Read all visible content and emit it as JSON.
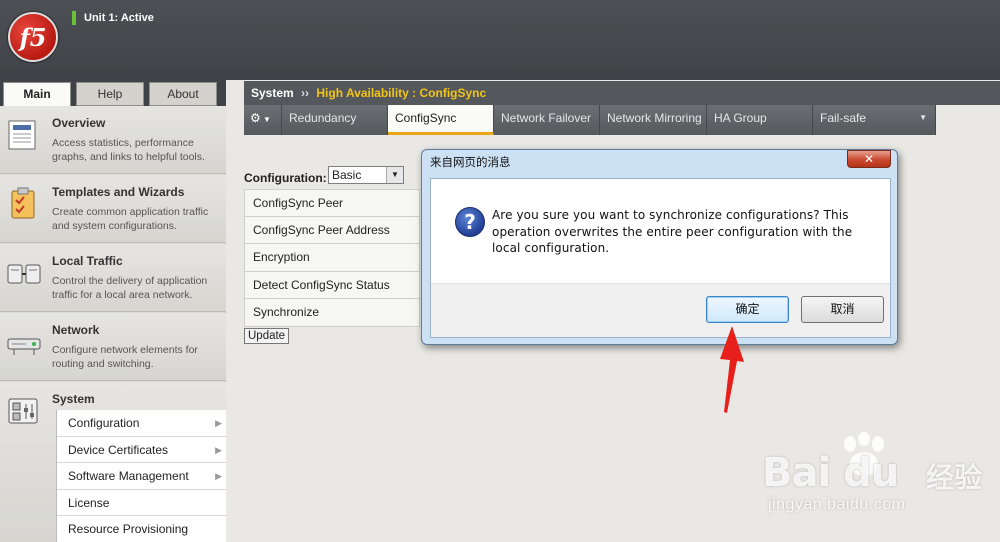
{
  "header": {
    "logo_text": "f5",
    "unit_status": "Unit 1: Active"
  },
  "sidebar": {
    "tabs": [
      {
        "label": "Main",
        "active": true
      },
      {
        "label": "Help",
        "active": false
      },
      {
        "label": "About",
        "active": false
      }
    ],
    "sections": [
      {
        "title": "Overview",
        "description": "Access statistics, performance graphs, and links to helpful tools.",
        "icon": "overview-icon"
      },
      {
        "title": "Templates and Wizards",
        "description": "Create common application traffic and system configurations.",
        "icon": "wizard-icon"
      },
      {
        "title": "Local Traffic",
        "description": "Control the delivery of application traffic for a local area network.",
        "icon": "local-traffic-icon"
      },
      {
        "title": "Network",
        "description": "Configure network elements for routing and switching.",
        "icon": "network-icon"
      },
      {
        "title": "System",
        "description": "",
        "icon": "system-icon"
      }
    ],
    "system_menu": [
      {
        "label": "Configuration",
        "has_submenu": true
      },
      {
        "label": "Device Certificates",
        "has_submenu": true
      },
      {
        "label": "Software Management",
        "has_submenu": true
      },
      {
        "label": "License",
        "has_submenu": false
      },
      {
        "label": "Resource Provisioning",
        "has_submenu": false
      }
    ]
  },
  "breadcrumb": {
    "root": "System",
    "separator": "››",
    "current": "High Availability : ConfigSync"
  },
  "tabs": [
    {
      "label": "Redundancy",
      "active": false
    },
    {
      "label": "ConfigSync",
      "active": true
    },
    {
      "label": "Network Failover",
      "active": false
    },
    {
      "label": "Network Mirroring",
      "active": false
    },
    {
      "label": "HA Group",
      "active": false
    },
    {
      "label": "Fail-safe",
      "active": false
    }
  ],
  "configuration": {
    "label": "Configuration:",
    "selected": "Basic"
  },
  "properties": [
    "ConfigSync Peer",
    "ConfigSync Peer Address",
    "Encryption",
    "Detect ConfigSync Status",
    "Synchronize"
  ],
  "update_button": "Update",
  "dialog": {
    "title": "来自网页的消息",
    "message": "Are you sure you want to synchronize configurations?  This operation overwrites the entire peer configuration with the local configuration.",
    "ok_label": "确定",
    "cancel_label": "取消",
    "close_label": "✕"
  },
  "watermark": {
    "brand": "Bai  du",
    "brand_cn": "经验",
    "url": "jingyan.baidu.com"
  },
  "colors": {
    "accent_yellow": "#f2c418",
    "active_green": "#6bbf39",
    "annotation_red": "#e8201c"
  }
}
